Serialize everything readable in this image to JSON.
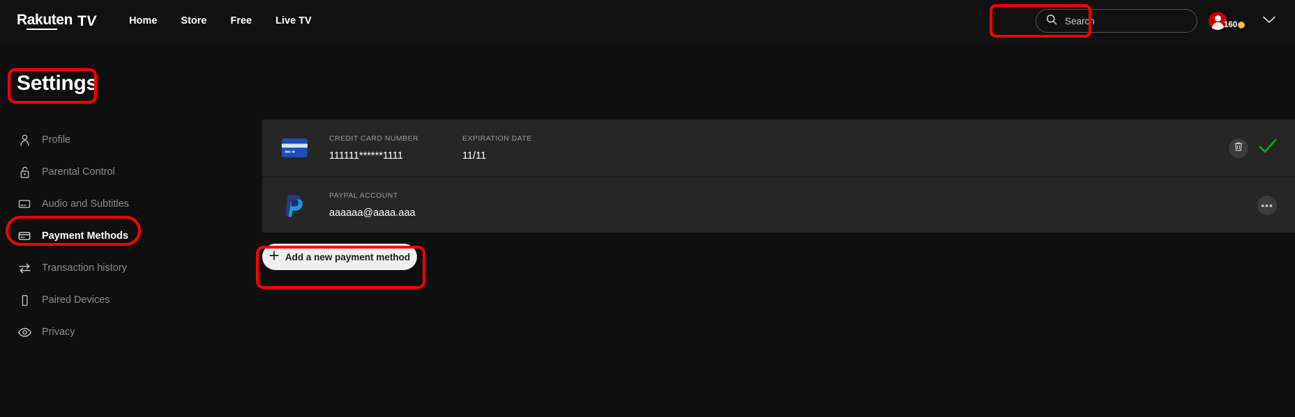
{
  "header": {
    "logo": {
      "word": "Rakuten",
      "tv": "TV"
    },
    "nav": [
      {
        "label": "Home"
      },
      {
        "label": "Store"
      },
      {
        "label": "Free"
      },
      {
        "label": "Live TV"
      }
    ],
    "search": {
      "placeholder": "Search",
      "icon": "search-icon"
    },
    "profile": {
      "points": "160",
      "coin_icon": "coin-icon",
      "chevron": "chevron-down-icon"
    }
  },
  "page": {
    "title": "Settings"
  },
  "sidebar": {
    "items": [
      {
        "label": "Profile",
        "icon": "person-icon",
        "active": false
      },
      {
        "label": "Parental Control",
        "icon": "lock-icon",
        "active": false
      },
      {
        "label": "Audio and Subtitles",
        "icon": "subtitles-icon",
        "active": false
      },
      {
        "label": "Payment Methods",
        "icon": "credit-card-icon",
        "active": true
      },
      {
        "label": "Transaction history",
        "icon": "transfer-arrows-icon",
        "active": false
      },
      {
        "label": "Paired Devices",
        "icon": "mobile-device-icon",
        "active": false
      },
      {
        "label": "Privacy",
        "icon": "eye-icon",
        "active": false
      }
    ]
  },
  "main": {
    "payment_methods": [
      {
        "type": "credit-card",
        "icon": "credit-card-blue-icon",
        "fields": [
          {
            "label": "CREDIT CARD NUMBER",
            "value": "111111******1111"
          },
          {
            "label": "EXPIRATION DATE",
            "value": "11/11"
          }
        ],
        "actions": [
          "delete-icon",
          "check-icon"
        ]
      },
      {
        "type": "paypal",
        "icon": "paypal-icon",
        "fields": [
          {
            "label": "PAYPAL ACCOUNT",
            "value": "aaaaaa@aaaa.aaa"
          }
        ],
        "actions": [
          "more-options-icon"
        ]
      }
    ],
    "add_button": {
      "label": "Add a new payment method",
      "icon": "plus-icon"
    }
  },
  "colors": {
    "background": "#0f0f0f",
    "header": "#111111",
    "row": "#262626",
    "brand_red": "#cc0000",
    "annotation_red": "#fe0000",
    "check_green": "#19a319",
    "card_blue": "#1a4fb4",
    "paypal_dark": "#253b80",
    "paypal_light": "#179bd7",
    "muted_text": "#8d8d8d",
    "label_text": "#9a9a9a",
    "add_button_bg": "#efefef"
  }
}
